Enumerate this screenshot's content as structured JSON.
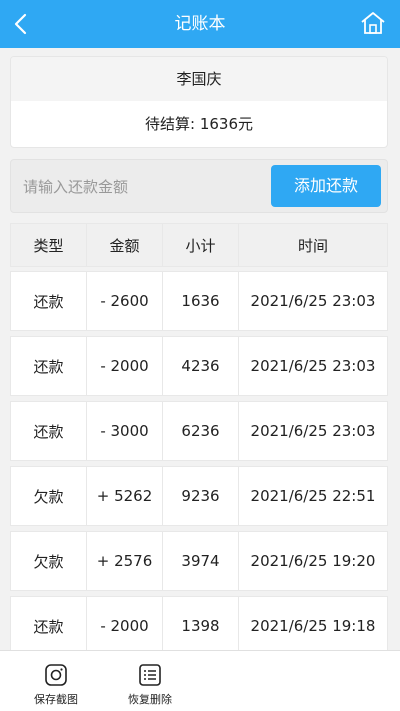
{
  "header": {
    "title": "记账本"
  },
  "account": {
    "name": "李国庆",
    "pending_label": "待结算: 1636元"
  },
  "repay": {
    "placeholder": "请输入还款金额",
    "add_button": "添加还款"
  },
  "table": {
    "columns": [
      "类型",
      "金额",
      "小计",
      "时间"
    ],
    "rows": [
      [
        "还款",
        "- 2600",
        "1636",
        "2021/6/25 23:03"
      ],
      [
        "还款",
        "- 2000",
        "4236",
        "2021/6/25 23:03"
      ],
      [
        "还款",
        "- 3000",
        "6236",
        "2021/6/25 23:03"
      ],
      [
        "欠款",
        "+ 5262",
        "9236",
        "2021/6/25 22:51"
      ],
      [
        "欠款",
        "+ 2576",
        "3974",
        "2021/6/25 19:20"
      ],
      [
        "还款",
        "- 2000",
        "1398",
        "2021/6/25 19:18"
      ]
    ]
  },
  "footer": {
    "save_screenshot": "保存截图",
    "restore_deleted": "恢复删除"
  },
  "colors": {
    "accent": "#2fa8f3"
  },
  "icons": {
    "back": "chevron-left-icon",
    "home": "home-icon",
    "camera": "camera-icon",
    "list": "list-icon"
  }
}
